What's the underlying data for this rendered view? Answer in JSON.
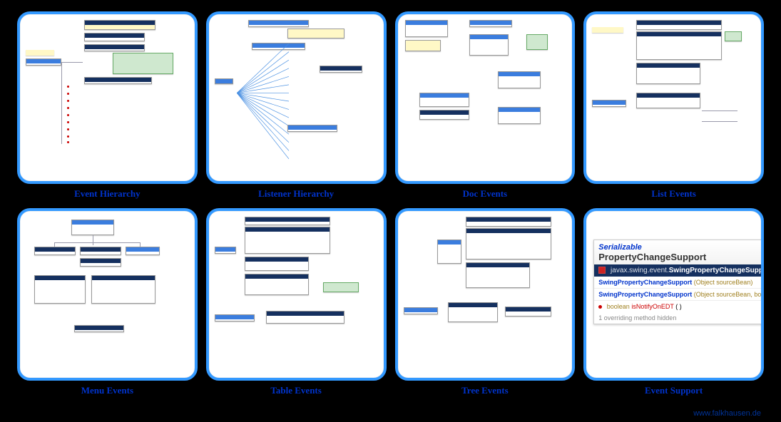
{
  "cards": [
    {
      "caption": "Event Hierarchy"
    },
    {
      "caption": "Listener Hierarchy"
    },
    {
      "caption": "Doc Events"
    },
    {
      "caption": "List Events"
    },
    {
      "caption": "Menu Events"
    },
    {
      "caption": "Table Events"
    },
    {
      "caption": "Tree Events"
    },
    {
      "caption": "Event Support"
    }
  ],
  "footer": "www.falkhausen.de",
  "event_support_panel": {
    "serializable": "Serializable",
    "classname": "PropertyChangeSupport",
    "full_class": "javax.swing.event.SwingPropertyChangeSupport",
    "full_class_prefix": "javax.swing.event.",
    "full_class_short": "SwingPropertyChangeSupport",
    "ctor1_name": "SwingPropertyChangeSupport",
    "ctor1_args": "(Object sourceBean)",
    "ctor2_name": "SwingPropertyChangeSupport",
    "ctor2_args": "(Object sourceBean, boolean notifyOn",
    "method_type": "boolean",
    "method_name": "isNotifyOnEDT",
    "method_args": "( )",
    "hidden_note": "1 overriding method hidden"
  }
}
